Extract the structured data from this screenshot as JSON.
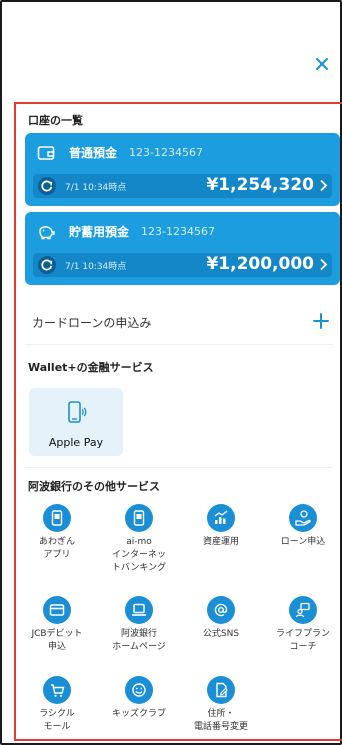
{
  "close_label": "×",
  "accounts_section": {
    "title": "口座の一覧",
    "accounts": [
      {
        "name": "普通預金",
        "number": "123-1234567",
        "timestamp": "7/1 10:34時点",
        "amount": "¥1,254,320",
        "chevron": "›",
        "icon": "wallet-icon"
      },
      {
        "name": "貯蓄用預金",
        "number": "123-1234567",
        "timestamp": "7/1 10:34時点",
        "amount": "¥1,200,000",
        "chevron": "›",
        "icon": "piggy-bank-icon"
      }
    ]
  },
  "loan": {
    "label": "カードローンの申込み",
    "action": "+"
  },
  "wallet_section": {
    "title": "Wallet+の金融サービス",
    "apple_pay": {
      "label": "Apple Pay",
      "icon": "nfc-phone-icon"
    }
  },
  "other_section": {
    "title": "阿波銀行のその他サービス",
    "items": [
      {
        "label": "あわぎん\nアプリ",
        "icon": "phone-app-icon"
      },
      {
        "label": "ai-mo\nインターネッ\nトバンキング",
        "icon": "phone-app-icon"
      },
      {
        "label": "資産運用",
        "icon": "chart-icon"
      },
      {
        "label": "ローン申込",
        "icon": "hand-coin-icon"
      },
      {
        "label": "JCBデビット\n申込",
        "icon": "card-icon"
      },
      {
        "label": "阿波銀行\nホームページ",
        "icon": "laptop-icon"
      },
      {
        "label": "公式SNS",
        "icon": "at-icon"
      },
      {
        "label": "ライフプラン\nコーチ",
        "icon": "coach-icon"
      },
      {
        "label": "ラシクル\nモール",
        "icon": "cart-icon"
      },
      {
        "label": "キッズクラブ",
        "icon": "smile-icon"
      },
      {
        "label": "住所・\n電話番号変更",
        "icon": "document-icon"
      }
    ]
  },
  "colors": {
    "accent": "#1b9de0",
    "highlight_border": "#e53935",
    "icon_bg": "#1b8fd6"
  }
}
